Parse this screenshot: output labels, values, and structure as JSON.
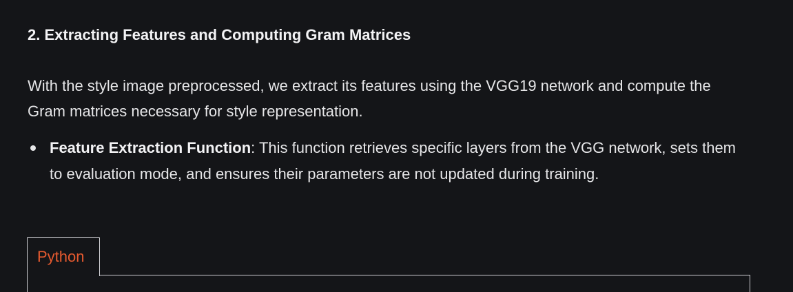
{
  "section": {
    "title": "2. Extracting Features and Computing Gram Matrices",
    "intro": "With the style image preprocessed, we extract its features using the VGG19 network and compute the Gram matrices necessary for style representation."
  },
  "bullets": [
    {
      "term": "Feature Extraction Function",
      "text": ": This function retrieves specific layers from the VGG network, sets them to evaluation mode, and ensures their parameters are not updated during training."
    }
  ],
  "code_block": {
    "tab_label": "Python"
  },
  "colors": {
    "background": "#141518",
    "text": "#e6e6e8",
    "tab_accent": "#e65a2f",
    "border": "#cfcfd3"
  }
}
